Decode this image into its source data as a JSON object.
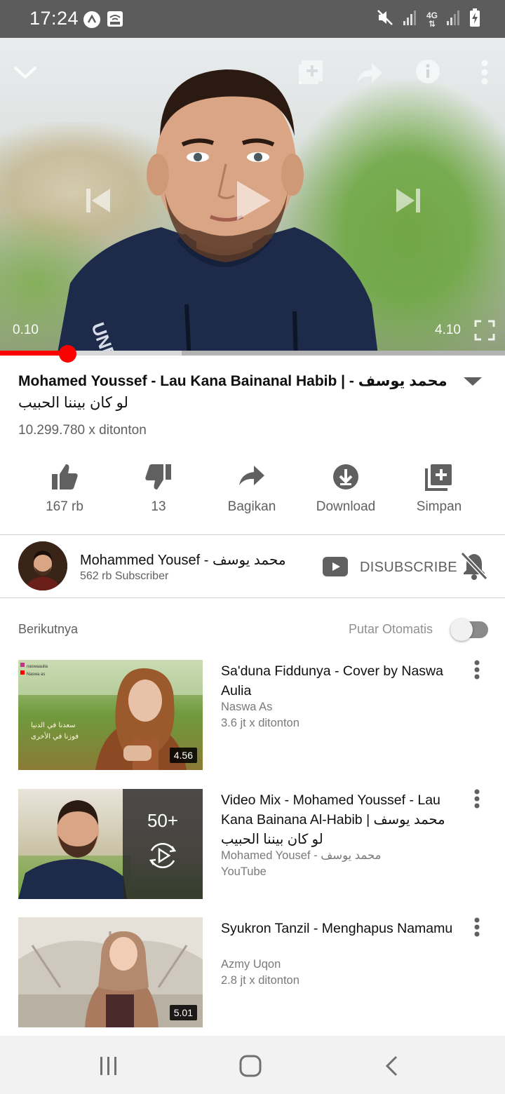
{
  "status_bar": {
    "time": "17:24",
    "network": "4G",
    "icons": [
      "assistant-icon",
      "wifi-calling-icon",
      "mute-icon",
      "signal-icon",
      "4g-icon",
      "signal-icon",
      "battery-charging-icon"
    ]
  },
  "player": {
    "current_time": "0.10",
    "total_time": "4.10",
    "progress_fraction": 0.134,
    "buffer_fraction": 0.36,
    "icons": [
      "chevron-down-icon",
      "add-to-playlist-icon",
      "share-icon",
      "info-icon",
      "more-vert-icon",
      "previous-icon",
      "play-icon",
      "next-icon",
      "fullscreen-icon"
    ]
  },
  "video": {
    "title": "Mohamed Youssef - Lau Kana Bainanal Habib | - محمد يوسف",
    "title_arabic": "لو كان بيننا الحبيب",
    "views": "10.299.780 x ditonton"
  },
  "actions": [
    {
      "label": "167 rb",
      "icon": "thumbs-up-icon"
    },
    {
      "label": "13",
      "icon": "thumbs-down-icon"
    },
    {
      "label": "Bagikan",
      "icon": "share-icon"
    },
    {
      "label": "Download",
      "icon": "download-icon"
    },
    {
      "label": "Simpan",
      "icon": "save-playlist-icon"
    }
  ],
  "channel": {
    "name": "Mohammed Yousef - محمد يوسف",
    "subscribers": "562 rb Subscriber",
    "unsubscribe_label": "DISUBSCRIBE"
  },
  "up_next": {
    "label": "Berikutnya",
    "autoplay_label": "Putar Otomatis",
    "autoplay_on": false
  },
  "items": [
    {
      "title": "Sa'duna Fiddunya - Cover by Naswa Aulia",
      "channel": "Naswa As",
      "meta": "3.6 jt x ditonton",
      "duration": "4.56"
    },
    {
      "title": "Video Mix - Mohamed Youssef - Lau Kana Bainana Al-Habib | محمد يوسف",
      "title_arabic": "لو كان بيننا الحبيب",
      "channel": "Mohamed Yousef - محمد يوسف",
      "meta": "YouTube",
      "mix_count": "50+"
    },
    {
      "title": "Syukron Tanzil - Menghapus Namamu",
      "channel": "Azmy Uqon",
      "meta": "2.8 jt x ditonton",
      "duration": "5.01"
    }
  ],
  "thumb_overlay_text": {
    "channel_tag": "naswaaulia",
    "channel_tag2": "Naswa as",
    "caption1": "سعدنا في الدنيا",
    "caption2": "فوزنا في الأخرى"
  },
  "colors": {
    "accent": "#ff0000",
    "status_bar": "#5c5c5c",
    "secondary_text": "#606060"
  }
}
